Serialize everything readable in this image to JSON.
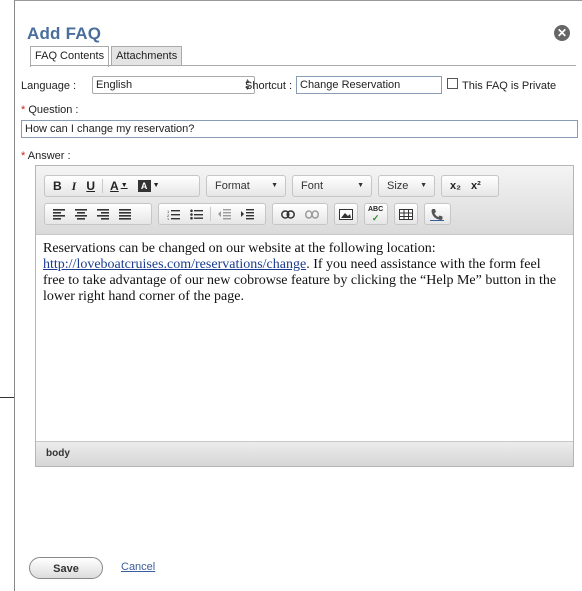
{
  "dialog": {
    "title": "Add FAQ",
    "close_icon": "close-circle-icon"
  },
  "tabs": [
    {
      "label": "FAQ Contents",
      "active": true
    },
    {
      "label": "Attachments",
      "active": false
    }
  ],
  "form": {
    "language_label": "Language :",
    "language_value": "English",
    "shortcut_label": "Shortcut :",
    "shortcut_value": "Change Reservation",
    "private_label": "This FAQ is Private",
    "private_checked": false,
    "question_required": "*",
    "question_label": "Question :",
    "question_value": "How can I change my reservation?",
    "answer_required": "*",
    "answer_label": "Answer :"
  },
  "toolbar": {
    "bold": "B",
    "italic": "I",
    "underline": "U",
    "text_color": "A",
    "format_label": "Format",
    "font_label": "Font",
    "size_label": "Size",
    "subscript": "x₂",
    "superscript": "x²",
    "spellcheck": "ABC"
  },
  "editor": {
    "text_before": "Reservations can be changed on our website at the following location: ",
    "link_text": "http://loveboatcruises.com/reservations/change",
    "text_after": ".  If you need assistance with the form feel free to take advantage of our new cobrowse feature by clicking the “Help Me” button in the lower right hand corner of the page.",
    "status_path": "body"
  },
  "actions": {
    "save_label": "Save",
    "cancel_label": "Cancel"
  },
  "colors": {
    "title": "#4a6e9c",
    "link": "#1a3c8f",
    "required": "#d02020"
  }
}
